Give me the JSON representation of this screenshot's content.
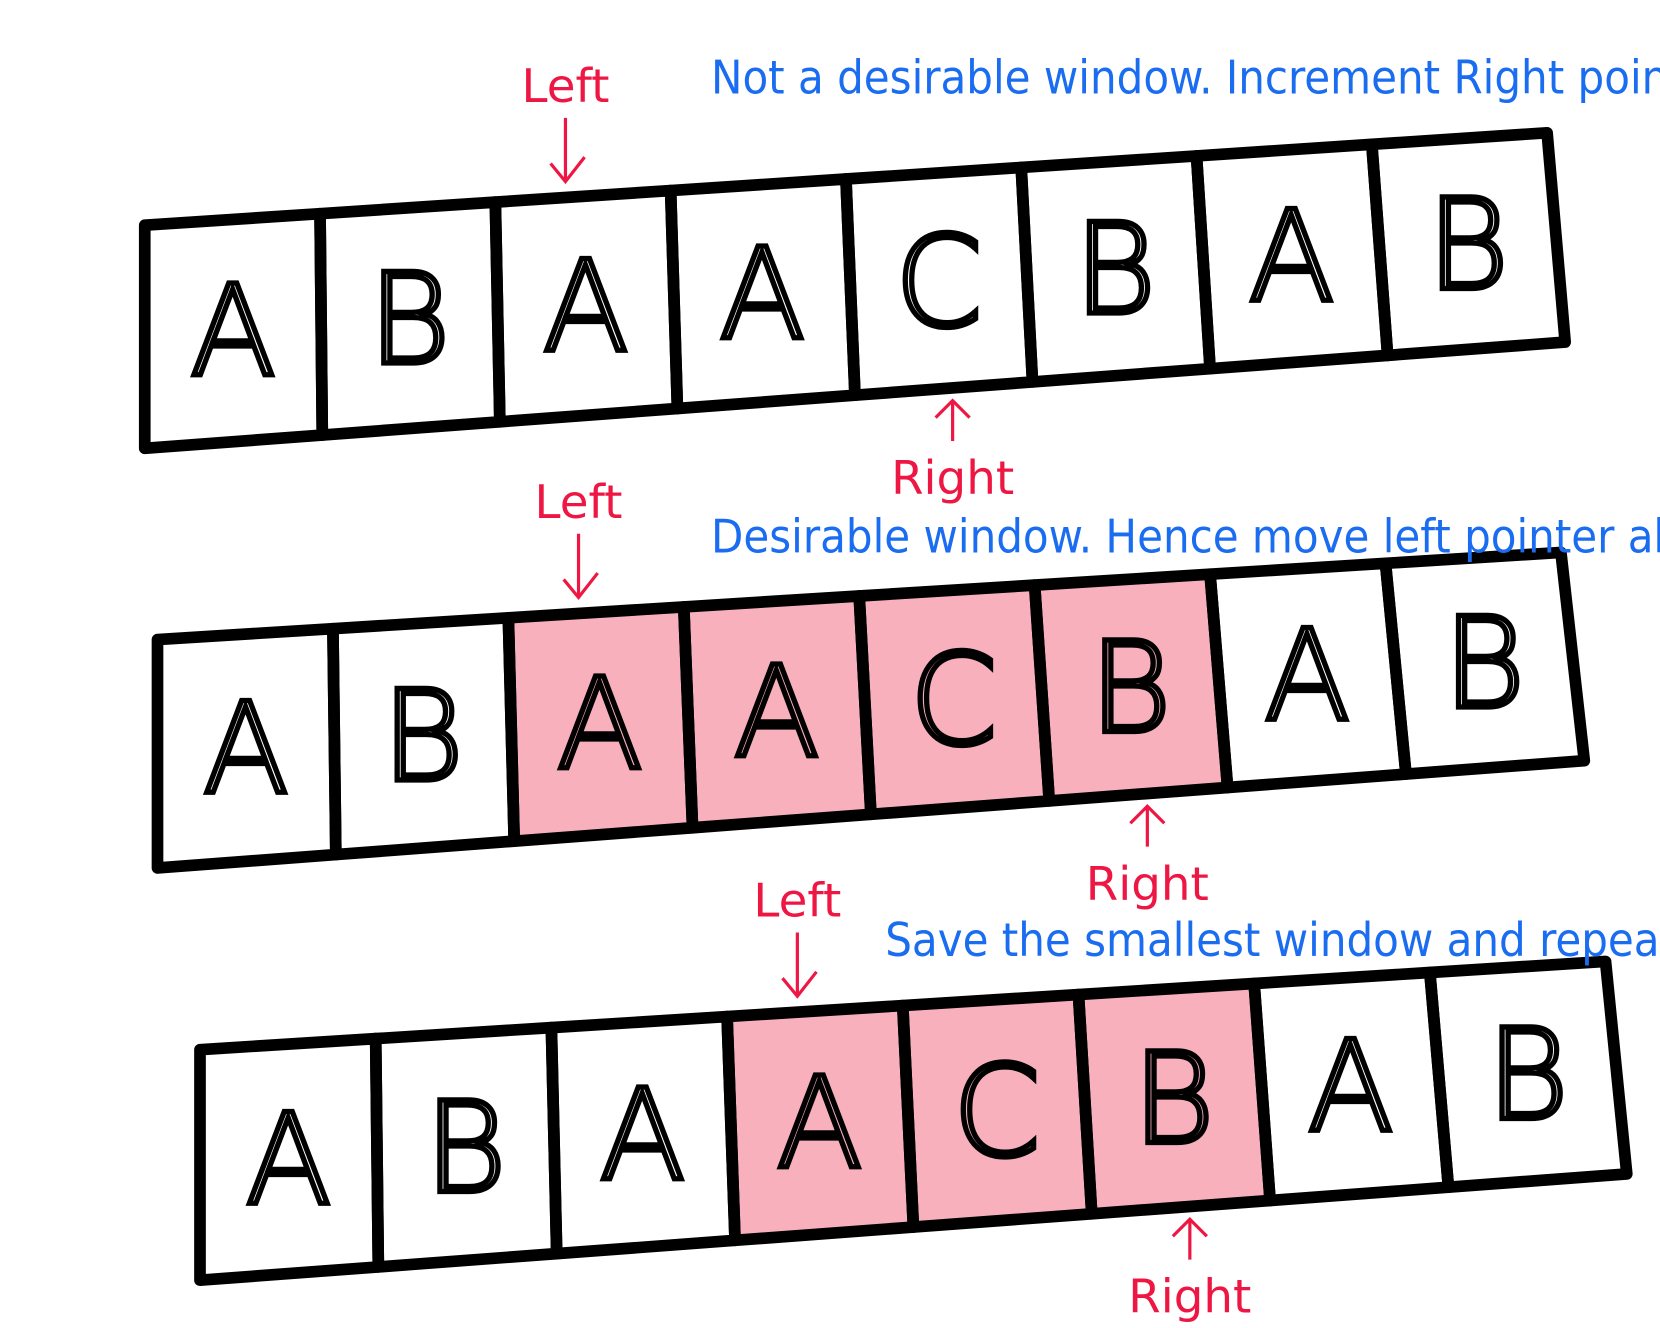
{
  "colors": {
    "caption": "#1a6cf0",
    "pointer": "#ee1744",
    "highlight": "#f7a2b2",
    "stroke": "#000000"
  },
  "pointer_labels": {
    "left": "Left",
    "right": "Right"
  },
  "rows": [
    {
      "caption": "Not a desirable window. Increment Right pointer.",
      "letters": [
        "A",
        "B",
        "A",
        "A",
        "C",
        "B",
        "A",
        "B"
      ],
      "highlight": null,
      "left_index": 2,
      "right_index": 4
    },
    {
      "caption": "Desirable window. Hence move left pointer ahead.",
      "letters": [
        "A",
        "B",
        "A",
        "A",
        "C",
        "B",
        "A",
        "B"
      ],
      "highlight": [
        2,
        5
      ],
      "left_index": 2,
      "right_index": 5
    },
    {
      "caption": "Save the smallest window and repeat.",
      "letters": [
        "A",
        "B",
        "A",
        "A",
        "C",
        "B",
        "A",
        "B"
      ],
      "highlight": [
        3,
        5
      ],
      "left_index": 3,
      "right_index": 5
    }
  ]
}
